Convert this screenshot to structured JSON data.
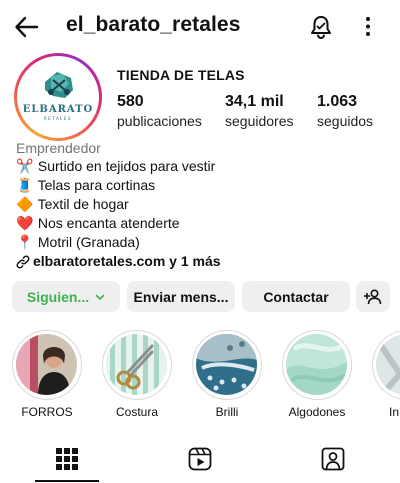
{
  "header": {
    "username": "el_barato_retales",
    "back_icon": "arrow-left-icon",
    "bell_icon": "notification-bell-icon",
    "more_icon": "more-vertical-icon"
  },
  "profile": {
    "avatar_text": "ELBARATO",
    "avatar_subtext": "RETALES",
    "name": "TIENDA DE TELAS",
    "stats": {
      "posts_count": "580",
      "posts_label": "publicaciones",
      "followers_count": "34,1 mil",
      "followers_label": "seguidores",
      "following_count": "1.063",
      "following_label": "seguidos"
    }
  },
  "bio": {
    "category": "Emprendedor",
    "lines": [
      {
        "emoji": "✂️",
        "text": "Surtido en tejidos para vestir"
      },
      {
        "emoji": "🧵",
        "text": "Telas para cortinas"
      },
      {
        "emoji": "🔶",
        "text": "Textil de hogar"
      },
      {
        "emoji": "❤️",
        "text": "Nos encanta atenderte"
      },
      {
        "emoji": "📍",
        "text": "Motril (Granada)"
      }
    ],
    "link": "elbaratoretales.com y 1 más"
  },
  "actions": {
    "following_label": "Siguien...",
    "message_label": "Enviar mens...",
    "contact_label": "Contactar",
    "following_color": "#3fb34f"
  },
  "highlights": [
    {
      "label": "FORROS"
    },
    {
      "label": "Costura"
    },
    {
      "label": "Brilli"
    },
    {
      "label": "Algodones"
    },
    {
      "label": "In"
    }
  ],
  "tabs": [
    {
      "icon": "grid-icon",
      "active": true
    },
    {
      "icon": "reels-icon",
      "active": false
    },
    {
      "icon": "tagged-icon",
      "active": false
    }
  ]
}
